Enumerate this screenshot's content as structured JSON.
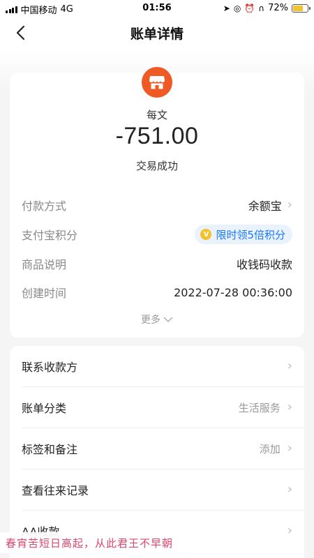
{
  "status_bar": {
    "carrier": "中国移动",
    "network": "4G",
    "time": "01:56",
    "battery_percent": "72%",
    "battery_level": 0.72
  },
  "nav": {
    "title": "账单详情",
    "back_icon": "back-arrow-icon"
  },
  "transaction": {
    "merchant_icon": "store-icon",
    "merchant_name": "每文",
    "amount": "-751.00",
    "status": "交易成功"
  },
  "details": [
    {
      "label": "付款方式",
      "value": "余额宝"
    },
    {
      "label": "支付宝积分",
      "value": "限时领5倍积分"
    },
    {
      "label": "商品说明",
      "value": "收钱码收款"
    },
    {
      "label": "创建时间",
      "value": "2022-07-28 00:36:00"
    }
  ],
  "more_label": "更多",
  "actions": [
    {
      "label": "联系收款方",
      "value": ""
    },
    {
      "label": "账单分类",
      "value": "生活服务"
    },
    {
      "label": "标签和备注",
      "value": "添加"
    },
    {
      "label": "查看往来记录",
      "value": ""
    },
    {
      "label": "AA收款",
      "value": ""
    }
  ],
  "watermark": "春宵苦短日高起，从此君王不早朝",
  "colors": {
    "merchant_logo": "#ef5a24",
    "points_blue": "#1677ff",
    "points_bg": "#eaf3fd",
    "watermark": "#e0446b"
  }
}
